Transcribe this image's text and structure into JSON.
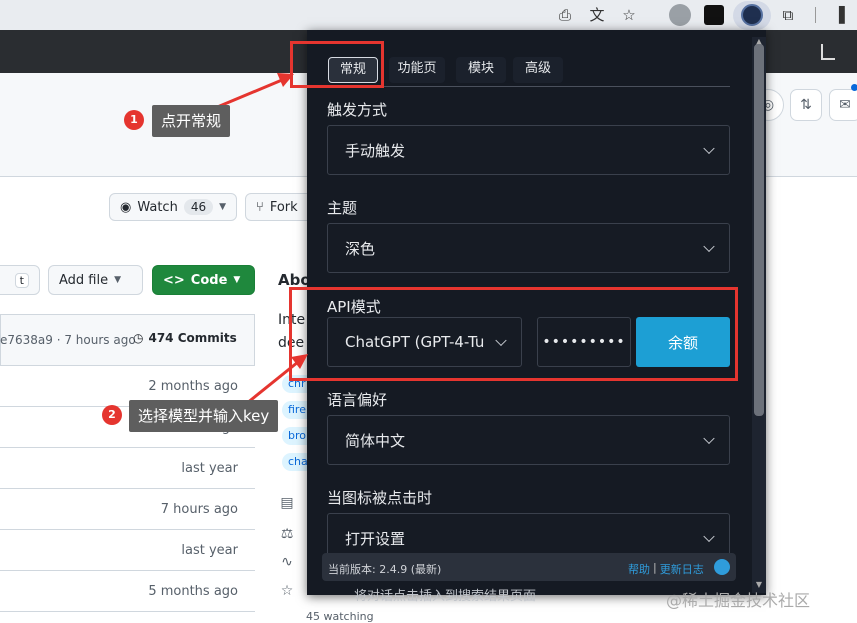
{
  "browser": {
    "icons": [
      "install-icon",
      "translate-icon",
      "star-icon",
      "extension-lightning-icon",
      "extension-black-icon",
      "extension-active-icon",
      "puzzle-icon",
      "sidepanel-icon"
    ]
  },
  "github": {
    "watch_label": "Watch",
    "watch_count": "46",
    "fork_label": "Fork",
    "t_label": "t",
    "add_file_label": "Add file",
    "code_label": "Code",
    "commit_hash": "e7638a9 · 7 hours ago",
    "commits_label": "474 Commits",
    "file_dates": [
      "2 months ago",
      "5 months ago",
      "last year",
      "7 hours ago",
      "last year",
      "5 months ago"
    ],
    "about_label": "Abo",
    "about_lines": [
      "Inte",
      "dee"
    ],
    "topics": [
      "chr",
      "fire",
      "bro",
      "cha"
    ]
  },
  "popup": {
    "tabs": [
      {
        "label": "常规",
        "active": true
      },
      {
        "label": "功能页",
        "active": false
      },
      {
        "label": "模块",
        "active": false
      },
      {
        "label": "高级",
        "active": false
      }
    ],
    "trigger": {
      "label": "触发方式",
      "value": "手动触发"
    },
    "theme": {
      "label": "主题",
      "value": "深色"
    },
    "api": {
      "label": "API模式",
      "model": "ChatGPT (GPT-4-Tu",
      "key_masked": "•••••••••",
      "balance_label": "余额"
    },
    "language": {
      "label": "语言偏好",
      "value": "简体中文"
    },
    "icon_click": {
      "label": "当图标被点击时",
      "value": "打开设置"
    },
    "footer": {
      "version": "当前版本: 2.4.9 (最新)",
      "help": "帮助",
      "sep": "|",
      "changelog": "更新日志"
    },
    "behind_text": "将对话点击插入到搜索结果页面",
    "behind_text2": "45 watching"
  },
  "annotations": {
    "step1": {
      "number": "1",
      "text": "点开常规"
    },
    "step2": {
      "number": "2",
      "text": "选择模型并输入key"
    },
    "color": "#e5352f"
  },
  "watermark": "@稀土掘金技术社区"
}
